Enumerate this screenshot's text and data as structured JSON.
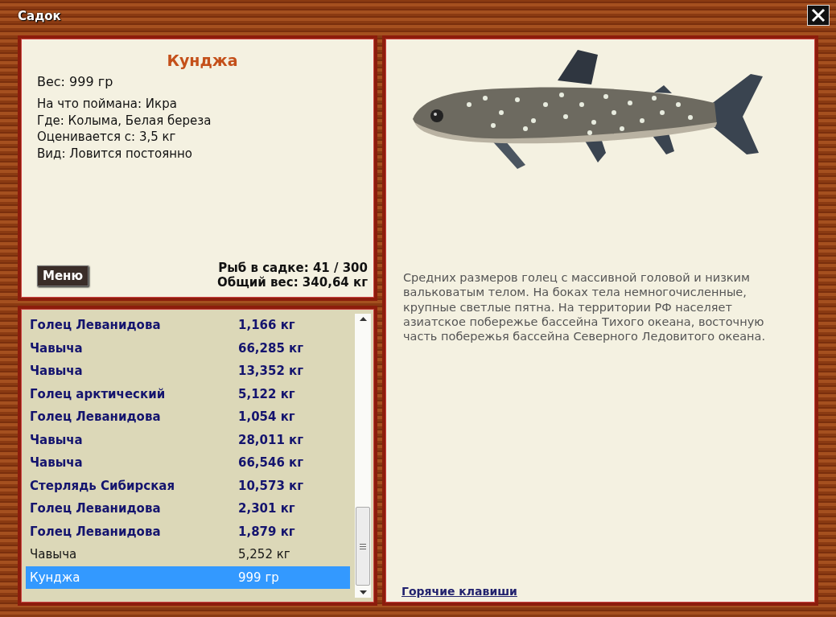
{
  "window": {
    "title": "Садок"
  },
  "fish": {
    "name": "Кунджа",
    "weight": "Вес: 999 гр",
    "details": [
      "На что поймана: Икра",
      "Где: Колыма, Белая береза",
      "Оценивается с: 3,5 кг",
      "Вид: Ловится постоянно"
    ]
  },
  "menu_button": "Меню",
  "stats": [
    "Рыб в садке: 41 / 300",
    "Общий вес: 340,64 кг"
  ],
  "catch_list": [
    {
      "name": "Голец Леванидова",
      "weight": "1,166 кг",
      "bold": true,
      "selected": false
    },
    {
      "name": "Чавыча",
      "weight": "66,285 кг",
      "bold": true,
      "selected": false
    },
    {
      "name": "Чавыча",
      "weight": "13,352 кг",
      "bold": true,
      "selected": false
    },
    {
      "name": "Голец арктический",
      "weight": "5,122 кг",
      "bold": true,
      "selected": false
    },
    {
      "name": "Голец Леванидова",
      "weight": "1,054 кг",
      "bold": true,
      "selected": false
    },
    {
      "name": "Чавыча",
      "weight": "28,011 кг",
      "bold": true,
      "selected": false
    },
    {
      "name": "Чавыча",
      "weight": "66,546 кг",
      "bold": true,
      "selected": false
    },
    {
      "name": "Стерлядь Сибирская",
      "weight": "10,573 кг",
      "bold": true,
      "selected": false
    },
    {
      "name": "Голец Леванидова",
      "weight": "2,301 кг",
      "bold": true,
      "selected": false
    },
    {
      "name": "Голец Леванидова",
      "weight": "1,879 кг",
      "bold": true,
      "selected": false
    },
    {
      "name": "Чавыча",
      "weight": "5,252 кг",
      "bold": false,
      "selected": false
    },
    {
      "name": "Кунджа",
      "weight": "999 гр",
      "bold": false,
      "selected": true
    }
  ],
  "description": "Средних размеров голец с массивной головой и низким вальковатым телом. На боках тела немногочисленные, крупные светлые пятна. На территории РФ населяет азиатское побережье бассейна Тихого океана, восточную часть побережья бассейна Северного Ледовитого океана.",
  "hotkeys_link": "Горячие клавиши"
}
